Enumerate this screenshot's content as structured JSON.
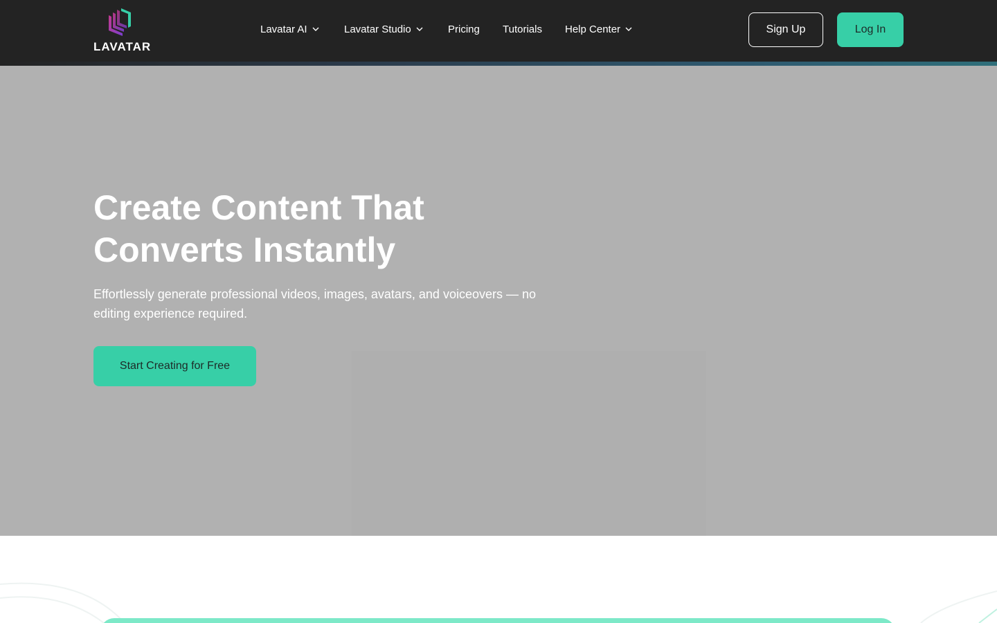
{
  "brand": {
    "name": "LAVATAR",
    "logo_icon": "lavatar-logo-icon"
  },
  "nav": {
    "items": [
      {
        "label": "Lavatar AI",
        "has_dropdown": true
      },
      {
        "label": "Lavatar Studio",
        "has_dropdown": true
      },
      {
        "label": "Pricing",
        "has_dropdown": false
      },
      {
        "label": "Tutorials",
        "has_dropdown": false
      },
      {
        "label": "Help Center",
        "has_dropdown": true
      }
    ]
  },
  "auth": {
    "signup_label": "Sign Up",
    "login_label": "Log In"
  },
  "hero": {
    "title_line1": "Create Content That",
    "title_line2": "Converts Instantly",
    "subtitle": "Effortlessly generate professional videos, images, avatars, and voiceovers — no editing experience required.",
    "cta_label": "Start Creating for Free"
  },
  "colors": {
    "header_bg": "#232323",
    "accent": "#37cfa7",
    "hero_bg": "#b1b1b1",
    "text_light": "#ffffff"
  }
}
